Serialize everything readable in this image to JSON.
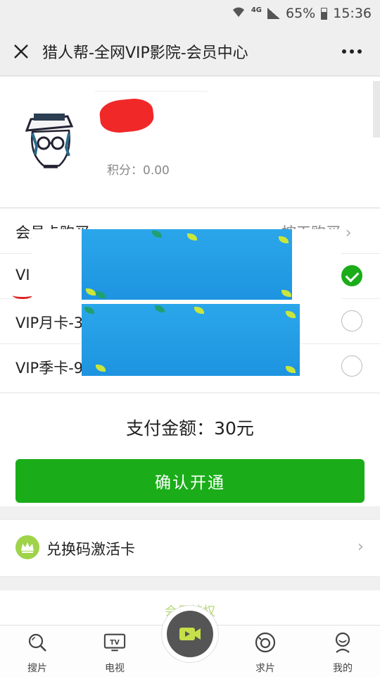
{
  "status_bar": {
    "network": "4G",
    "battery": "65%",
    "time": "15:36"
  },
  "header": {
    "title": "猎人帮-全网VIP影院-会员中心",
    "close_icon": "close-icon",
    "more_icon": "more-icon"
  },
  "profile": {
    "points": "积分：0.00"
  },
  "cards": {
    "header_label": "会员卡购买",
    "header_action": "按天购买",
    "rows": [
      {
        "label": "VI",
        "selected": true
      },
      {
        "label": "VIP月卡-3",
        "selected": false
      },
      {
        "label": "VIP季卡-9",
        "selected": false
      }
    ]
  },
  "payment": {
    "amount": "支付金额：30元",
    "confirm_label": "确认开通"
  },
  "redeem": {
    "label": "兑换码激活卡"
  },
  "privileges": {
    "title": "会员特权"
  },
  "bottom_nav": [
    {
      "label": "搜片",
      "icon": "search-icon"
    },
    {
      "label": "电视",
      "icon": "tv-icon"
    },
    {
      "label": "",
      "icon": "video-icon"
    },
    {
      "label": "求片",
      "icon": "request-icon"
    },
    {
      "label": "我的",
      "icon": "profile-icon"
    }
  ],
  "colors": {
    "accent": "#1aad19",
    "banner": "#2ba6ea"
  }
}
